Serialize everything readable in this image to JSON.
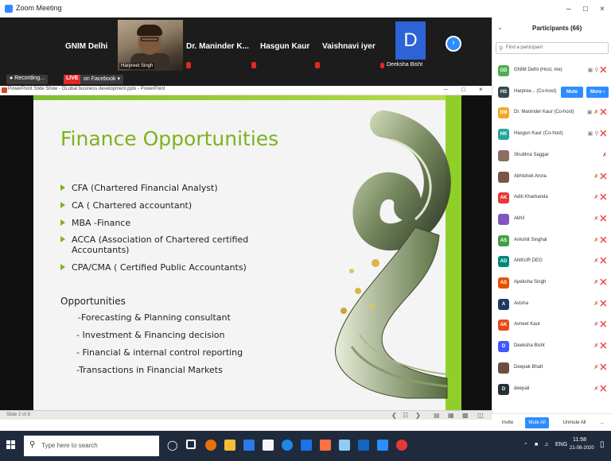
{
  "zoom": {
    "window_title": "Zoom Meeting",
    "video_tiles": [
      {
        "name": "GNIM Delhi"
      },
      {
        "name": "Harpreet Singh"
      },
      {
        "name": "Dr. Maninder  K..."
      },
      {
        "name": "Hasgun Kaur"
      },
      {
        "name": "Vaishnavi iyer"
      },
      {
        "name": "Deeksha Bisht",
        "initial": "D"
      }
    ],
    "recording_label": "Recording...",
    "live_label": "LIVE",
    "facebook_label": "on Facebook"
  },
  "ppt": {
    "window_title": "PowerPoint Slide Show  -  GLobal business development.pptx  -  PowerPoint",
    "slide_indicator": "Slide 2 of 8",
    "slide": {
      "title": "Finance Opportunities",
      "bullets": [
        "CFA (Chartered Financial Analyst)",
        "CA ( Chartered accountant)",
        "MBA -Finance",
        "ACCA (Association of Chartered certified Accountants)",
        "CPA/CMA ( Certified Public Accountants)"
      ],
      "opportunities_heading": "Opportunities",
      "opportunities": [
        "-Forecasting & Planning consultant",
        "- Investment & Financing decision",
        "- Financial & internal control reporting",
        "-Transactions in Financial Markets"
      ]
    }
  },
  "participants": {
    "title": "Participants (66)",
    "search_placeholder": "Find a participant",
    "list": [
      {
        "initials": "GD",
        "name": "GNIM Delhi (Host, me)",
        "color": "#4caf50"
      },
      {
        "initials": "HS",
        "name": "Harpree...  (Co-host)",
        "color": "#37474f"
      },
      {
        "initials": "DM",
        "name": "Dr. Maninder Kaur (Co-host)",
        "color": "#f5a623"
      },
      {
        "initials": "HK",
        "name": "Hasgun Kaur (Co-host)",
        "color": "#26a69a"
      },
      {
        "initials": "",
        "name": "Shubhra Saggar",
        "color": "#8d6e63"
      },
      {
        "initials": "",
        "name": "Abhishek Arora",
        "color": "#795548"
      },
      {
        "initials": "AK",
        "name": "Aditi Kharbanda",
        "color": "#e53935"
      },
      {
        "initials": "",
        "name": "Akhil",
        "color": "#7e57c2"
      },
      {
        "initials": "AS",
        "name": "Ankshit Singhal",
        "color": "#43a047"
      },
      {
        "initials": "AD",
        "name": "ANKUR DEO",
        "color": "#00897b"
      },
      {
        "initials": "AS",
        "name": "Apeksha Singh",
        "color": "#e65100"
      },
      {
        "initials": "A",
        "name": "Avisha",
        "color": "#1e3a5f"
      },
      {
        "initials": "AK",
        "name": "Avneet Kaur",
        "color": "#e64a19"
      },
      {
        "initials": "D",
        "name": "Deeksha Bisht",
        "color": "#3d5afe"
      },
      {
        "initials": "",
        "name": "Deepak Bhatt",
        "color": "#6d4c41"
      },
      {
        "initials": "D",
        "name": "deepali",
        "color": "#263238"
      }
    ],
    "mute_label": "Mute",
    "more_label": "More ›",
    "invite_label": "Invite",
    "mute_all_label": "Mute All",
    "unmute_all_label": "Unmute All",
    "more_dots": "..."
  },
  "taskbar": {
    "search_placeholder": "Type here to search",
    "lang": "ENG",
    "time": "11:58",
    "date": "21-08-2020"
  }
}
